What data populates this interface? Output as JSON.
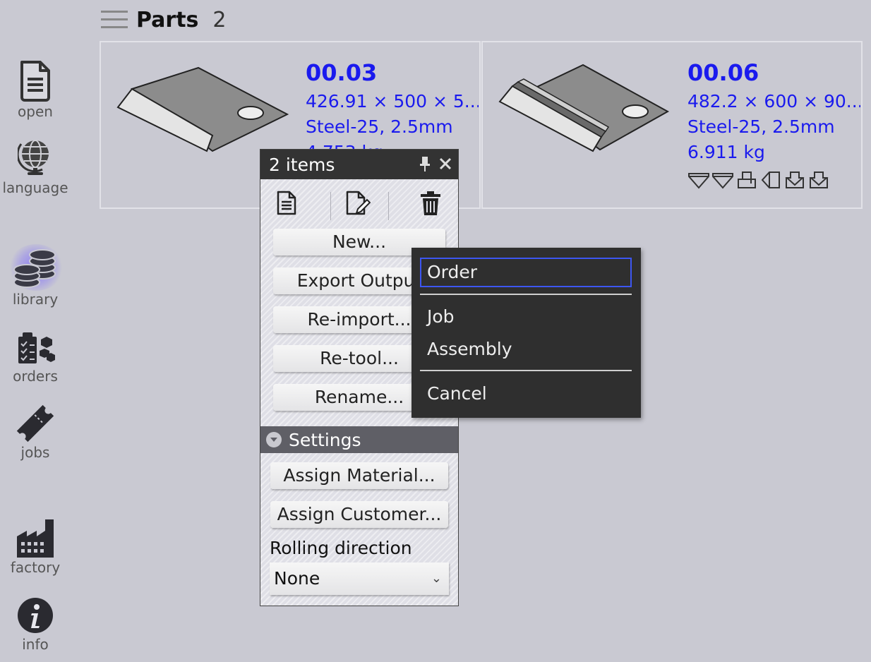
{
  "header": {
    "title": "Parts",
    "count": "2"
  },
  "sidebar": {
    "items": [
      {
        "label": "open",
        "icon": "document-icon"
      },
      {
        "label": "language",
        "icon": "globe-icon"
      },
      {
        "label": "library",
        "icon": "coins-stack-icon",
        "active": true
      },
      {
        "label": "orders",
        "icon": "orders-checklist-icon"
      },
      {
        "label": "jobs",
        "icon": "ticket-icon"
      },
      {
        "label": "factory",
        "icon": "factory-icon"
      },
      {
        "label": "info",
        "icon": "info-icon"
      }
    ]
  },
  "parts": [
    {
      "name": "00.03",
      "dims": "426.91 × 500 × 5...",
      "material": "Steel-25, 2.5mm",
      "weight": "4.753 kg"
    },
    {
      "name": "00.06",
      "dims": "482.2 × 600 × 90...",
      "material": "Steel-25, 2.5mm",
      "weight": "6.911 kg"
    }
  ],
  "panel": {
    "title": "2 items",
    "buttons": {
      "new": "New...",
      "export": "Export Output",
      "reimport": "Re-import...",
      "retool": "Re-tool...",
      "rename": "Rename..."
    },
    "settings_label": "Settings",
    "assign_material": "Assign Material...",
    "assign_customer": "Assign Customer...",
    "rolling_label": "Rolling direction",
    "rolling_value": "None"
  },
  "menu": {
    "items": [
      "Order",
      "Job",
      "Assembly",
      "Cancel"
    ]
  },
  "colors": {
    "link_blue": "#1a1aee",
    "panel_header": "#333333",
    "menu_focus": "#3d56f2",
    "background": "#c9c9d2"
  }
}
